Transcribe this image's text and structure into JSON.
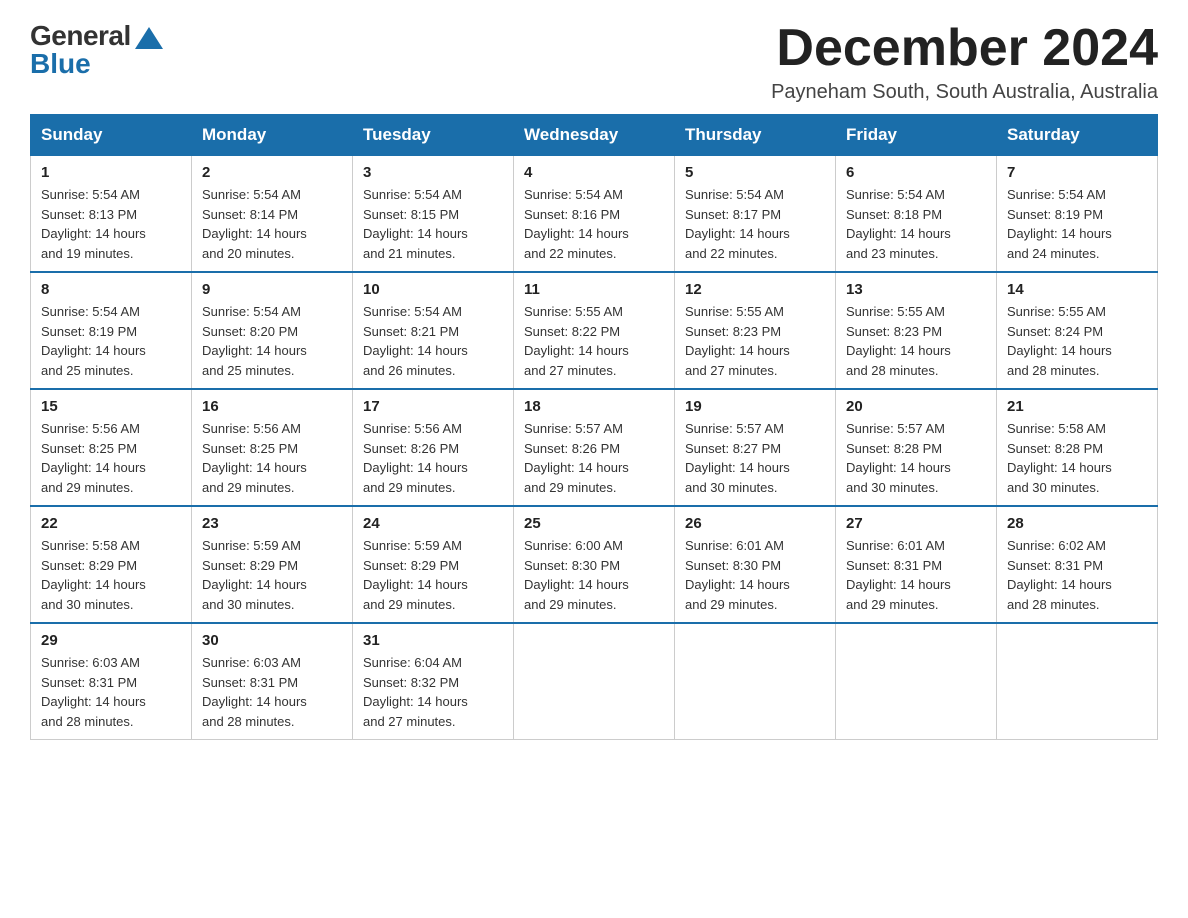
{
  "logo": {
    "general": "General",
    "blue": "Blue"
  },
  "header": {
    "month": "December 2024",
    "location": "Payneham South, South Australia, Australia"
  },
  "weekdays": [
    "Sunday",
    "Monday",
    "Tuesday",
    "Wednesday",
    "Thursday",
    "Friday",
    "Saturday"
  ],
  "weeks": [
    [
      {
        "day": "1",
        "sunrise": "5:54 AM",
        "sunset": "8:13 PM",
        "daylight": "14 hours and 19 minutes."
      },
      {
        "day": "2",
        "sunrise": "5:54 AM",
        "sunset": "8:14 PM",
        "daylight": "14 hours and 20 minutes."
      },
      {
        "day": "3",
        "sunrise": "5:54 AM",
        "sunset": "8:15 PM",
        "daylight": "14 hours and 21 minutes."
      },
      {
        "day": "4",
        "sunrise": "5:54 AM",
        "sunset": "8:16 PM",
        "daylight": "14 hours and 22 minutes."
      },
      {
        "day": "5",
        "sunrise": "5:54 AM",
        "sunset": "8:17 PM",
        "daylight": "14 hours and 22 minutes."
      },
      {
        "day": "6",
        "sunrise": "5:54 AM",
        "sunset": "8:18 PM",
        "daylight": "14 hours and 23 minutes."
      },
      {
        "day": "7",
        "sunrise": "5:54 AM",
        "sunset": "8:19 PM",
        "daylight": "14 hours and 24 minutes."
      }
    ],
    [
      {
        "day": "8",
        "sunrise": "5:54 AM",
        "sunset": "8:19 PM",
        "daylight": "14 hours and 25 minutes."
      },
      {
        "day": "9",
        "sunrise": "5:54 AM",
        "sunset": "8:20 PM",
        "daylight": "14 hours and 25 minutes."
      },
      {
        "day": "10",
        "sunrise": "5:54 AM",
        "sunset": "8:21 PM",
        "daylight": "14 hours and 26 minutes."
      },
      {
        "day": "11",
        "sunrise": "5:55 AM",
        "sunset": "8:22 PM",
        "daylight": "14 hours and 27 minutes."
      },
      {
        "day": "12",
        "sunrise": "5:55 AM",
        "sunset": "8:23 PM",
        "daylight": "14 hours and 27 minutes."
      },
      {
        "day": "13",
        "sunrise": "5:55 AM",
        "sunset": "8:23 PM",
        "daylight": "14 hours and 28 minutes."
      },
      {
        "day": "14",
        "sunrise": "5:55 AM",
        "sunset": "8:24 PM",
        "daylight": "14 hours and 28 minutes."
      }
    ],
    [
      {
        "day": "15",
        "sunrise": "5:56 AM",
        "sunset": "8:25 PM",
        "daylight": "14 hours and 29 minutes."
      },
      {
        "day": "16",
        "sunrise": "5:56 AM",
        "sunset": "8:25 PM",
        "daylight": "14 hours and 29 minutes."
      },
      {
        "day": "17",
        "sunrise": "5:56 AM",
        "sunset": "8:26 PM",
        "daylight": "14 hours and 29 minutes."
      },
      {
        "day": "18",
        "sunrise": "5:57 AM",
        "sunset": "8:26 PM",
        "daylight": "14 hours and 29 minutes."
      },
      {
        "day": "19",
        "sunrise": "5:57 AM",
        "sunset": "8:27 PM",
        "daylight": "14 hours and 30 minutes."
      },
      {
        "day": "20",
        "sunrise": "5:57 AM",
        "sunset": "8:28 PM",
        "daylight": "14 hours and 30 minutes."
      },
      {
        "day": "21",
        "sunrise": "5:58 AM",
        "sunset": "8:28 PM",
        "daylight": "14 hours and 30 minutes."
      }
    ],
    [
      {
        "day": "22",
        "sunrise": "5:58 AM",
        "sunset": "8:29 PM",
        "daylight": "14 hours and 30 minutes."
      },
      {
        "day": "23",
        "sunrise": "5:59 AM",
        "sunset": "8:29 PM",
        "daylight": "14 hours and 30 minutes."
      },
      {
        "day": "24",
        "sunrise": "5:59 AM",
        "sunset": "8:29 PM",
        "daylight": "14 hours and 29 minutes."
      },
      {
        "day": "25",
        "sunrise": "6:00 AM",
        "sunset": "8:30 PM",
        "daylight": "14 hours and 29 minutes."
      },
      {
        "day": "26",
        "sunrise": "6:01 AM",
        "sunset": "8:30 PM",
        "daylight": "14 hours and 29 minutes."
      },
      {
        "day": "27",
        "sunrise": "6:01 AM",
        "sunset": "8:31 PM",
        "daylight": "14 hours and 29 minutes."
      },
      {
        "day": "28",
        "sunrise": "6:02 AM",
        "sunset": "8:31 PM",
        "daylight": "14 hours and 28 minutes."
      }
    ],
    [
      {
        "day": "29",
        "sunrise": "6:03 AM",
        "sunset": "8:31 PM",
        "daylight": "14 hours and 28 minutes."
      },
      {
        "day": "30",
        "sunrise": "6:03 AM",
        "sunset": "8:31 PM",
        "daylight": "14 hours and 28 minutes."
      },
      {
        "day": "31",
        "sunrise": "6:04 AM",
        "sunset": "8:32 PM",
        "daylight": "14 hours and 27 minutes."
      },
      null,
      null,
      null,
      null
    ]
  ],
  "labels": {
    "sunrise": "Sunrise:",
    "sunset": "Sunset:",
    "daylight": "Daylight:"
  }
}
